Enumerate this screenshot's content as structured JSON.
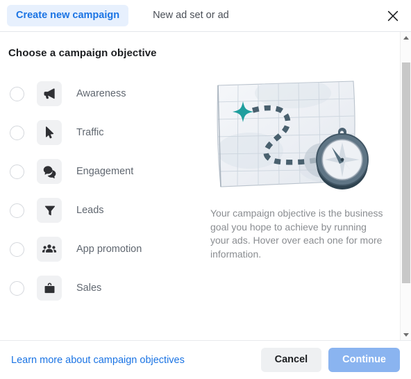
{
  "header": {
    "tabs": [
      {
        "label": "Create new campaign",
        "active": true
      },
      {
        "label": "New ad set or ad",
        "active": false
      }
    ],
    "close_icon": "close-icon"
  },
  "main": {
    "section_title": "Choose a campaign objective",
    "objectives": [
      {
        "label": "Awareness",
        "icon": "megaphone-icon",
        "selected": false
      },
      {
        "label": "Traffic",
        "icon": "cursor-icon",
        "selected": false
      },
      {
        "label": "Engagement",
        "icon": "chat-bubbles-icon",
        "selected": false
      },
      {
        "label": "Leads",
        "icon": "funnel-icon",
        "selected": false
      },
      {
        "label": "App promotion",
        "icon": "people-icon",
        "selected": false
      },
      {
        "label": "Sales",
        "icon": "shopping-bag-icon",
        "selected": false
      }
    ],
    "illustration": {
      "name": "map-with-compass-illustration",
      "star_color": "#1f9e9e",
      "route_color": "#49606e",
      "compass_color": "#3c5160",
      "map_color": "#eef1f5"
    },
    "description": "Your campaign objective is the business goal you hope to achieve by running your ads. Hover over each one for more information."
  },
  "scrollbar": {
    "up_icon": "caret-up-icon",
    "down_icon": "caret-down-icon"
  },
  "footer": {
    "learn_more_label": "Learn more about campaign objectives",
    "cancel_label": "Cancel",
    "continue_label": "Continue",
    "continue_enabled": false
  },
  "colors": {
    "accent_blue": "#1b74e4",
    "tab_active_bg": "#e7f0fd",
    "continue_disabled": "#8ab4f0",
    "cancel_bg": "#eef0f2",
    "icon_tile_bg": "#f0f1f3"
  }
}
